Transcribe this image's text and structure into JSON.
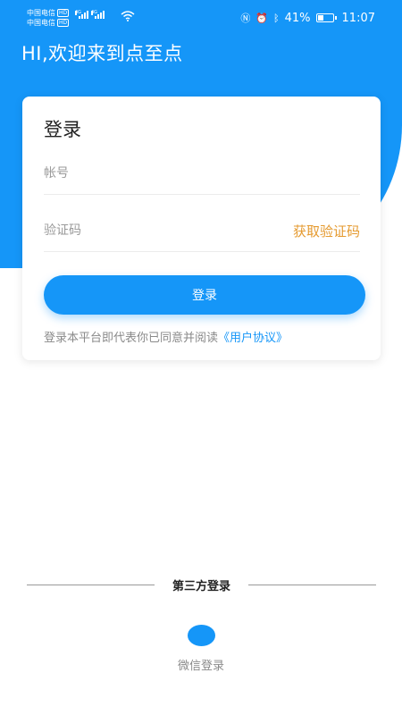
{
  "status_bar": {
    "carrier1": "中国电信",
    "carrier2": "中国电信",
    "hd": "HD",
    "net": "4G",
    "battery_percent": "41%",
    "battery_level": 0.41,
    "time": "11:07"
  },
  "header": {
    "greeting": "HI,欢迎来到点至点",
    "bg_color": "#1596f8"
  },
  "login_card": {
    "title": "登录",
    "account_placeholder": "帐号",
    "code_placeholder": "验证码",
    "get_code_label": "获取验证码",
    "login_button": "登录",
    "agreement_text": "登录本平台即代表你已同意并阅读",
    "agreement_link": "《用户协议》"
  },
  "third_party": {
    "divider_label": "第三方登录",
    "wechat_label": "微信登录"
  },
  "colors": {
    "accent": "#1596f8",
    "get_code": "#e59a2f"
  }
}
